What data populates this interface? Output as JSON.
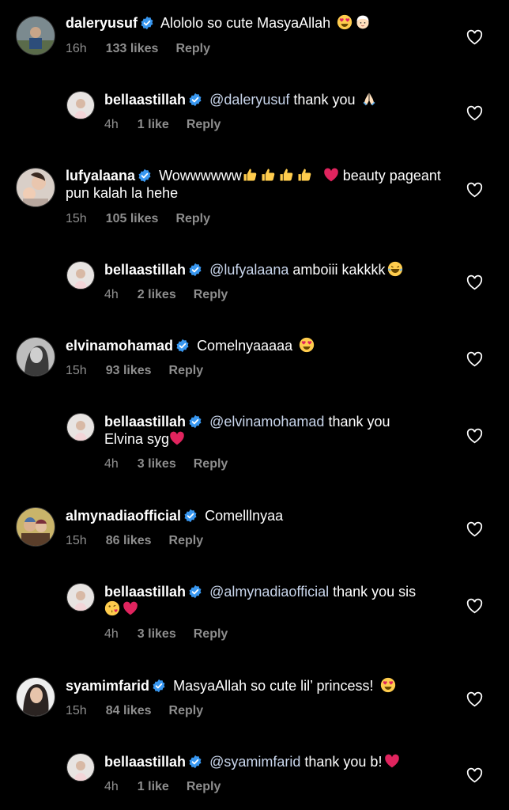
{
  "comments": [
    {
      "user": "daleryusuf",
      "text": "Alololo so cute MasyaAllah",
      "time": "16h",
      "likes": "133 likes",
      "reply": "Reply"
    },
    {
      "user": "bellaastillah",
      "mention": "@daleryusuf",
      "text": "thank you",
      "time": "4h",
      "likes": "1 like",
      "reply": "Reply"
    },
    {
      "user": "lufyalaana",
      "text": "Wowwwwww",
      "text2": "beauty pageant pun kalah la hehe",
      "time": "15h",
      "likes": "105 likes",
      "reply": "Reply"
    },
    {
      "user": "bellaastillah",
      "mention": "@lufyalaana",
      "text": "amboiii kakkkk",
      "time": "4h",
      "likes": "2 likes",
      "reply": "Reply"
    },
    {
      "user": "elvinamohamad",
      "text": "Comelnyaaaaa",
      "time": "15h",
      "likes": "93 likes",
      "reply": "Reply"
    },
    {
      "user": "bellaastillah",
      "mention": "@elvinamohamad",
      "text": "thank you",
      "text2": "Elvina syg",
      "time": "4h",
      "likes": "3 likes",
      "reply": "Reply"
    },
    {
      "user": "almynadiaofficial",
      "text": "Comelllnyaa",
      "time": "15h",
      "likes": "86 likes",
      "reply": "Reply"
    },
    {
      "user": "bellaastillah",
      "mention": "@almynadiaofficial",
      "text": "thank you sis",
      "time": "4h",
      "likes": "3 likes",
      "reply": "Reply"
    },
    {
      "user": "syamimfarid",
      "text": "MasyaAllah so cute lil’ princess!",
      "time": "15h",
      "likes": "84 likes",
      "reply": "Reply"
    },
    {
      "user": "bellaastillah",
      "mention": "@syamimfarid",
      "text": "thank you b!",
      "time": "4h",
      "likes": "1 like",
      "reply": "Reply"
    }
  ],
  "colors": {
    "verified": "#3897f0",
    "heart_emoji": "#e0245e",
    "muted": "#8e8e8e"
  }
}
